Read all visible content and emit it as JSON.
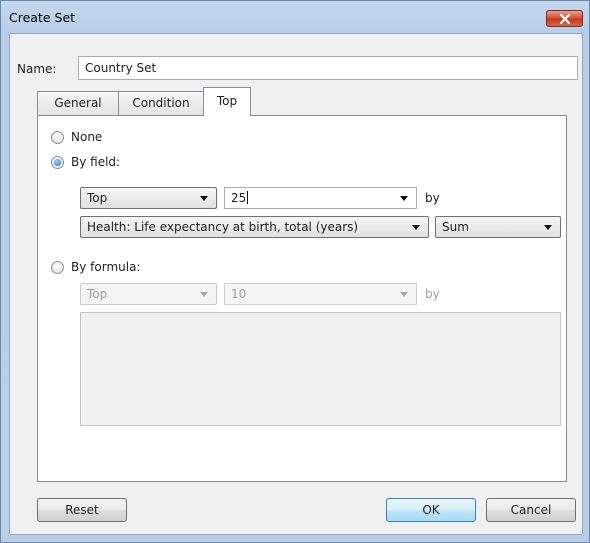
{
  "window": {
    "title": "Create Set"
  },
  "name": {
    "label": "Name:",
    "value": "Country Set"
  },
  "tabs": [
    {
      "label": "General",
      "active": false
    },
    {
      "label": "Condition",
      "active": false
    },
    {
      "label": "Top",
      "active": true
    }
  ],
  "top_tab": {
    "none_label": "None",
    "by_field": {
      "label": "By field:",
      "checked": true,
      "direction": "Top",
      "count": "25",
      "by_label": "by",
      "field": "Health: Life expectancy at birth, total (years)",
      "aggregation": "Sum"
    },
    "by_formula": {
      "label": "By formula:",
      "checked": false,
      "direction": "Top",
      "count": "10",
      "by_label": "by",
      "formula_text": ""
    }
  },
  "buttons": {
    "reset": "Reset",
    "ok": "OK",
    "cancel": "Cancel"
  },
  "colors": {
    "title_bar": "#b9cfe9",
    "close_button": "#c9432b",
    "radio_selected": "#1f6fc4"
  }
}
